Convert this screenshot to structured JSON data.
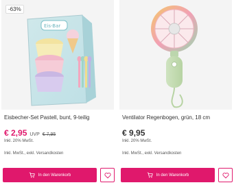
{
  "products": [
    {
      "badge": "-63%",
      "title": "Eisbecher-Set Pastell, bunt, 9-teilig",
      "price": "€ 2,95",
      "uvp_label": "UVP",
      "uvp_value": "€ 7,95",
      "vat": "Inkl. 20% MwSt.",
      "shipping": "Inkl. MwSt., exkl. Versandkosten",
      "cart_label": "In den Warenkorb",
      "image_icon": "ice-cream-set-image",
      "package_brand": "Eis-Bar"
    },
    {
      "title": "Ventilator Regenbogen, grün, 18 cm",
      "price": "€ 9,95",
      "vat": "Inkl. 20% MwSt.",
      "shipping": "Inkl. MwSt., exkl. Versandkosten",
      "cart_label": "In den Warenkorb",
      "image_icon": "handheld-fan-image"
    }
  ],
  "colors": {
    "accent": "#e0186c",
    "image_background": "#f4f4f4"
  }
}
